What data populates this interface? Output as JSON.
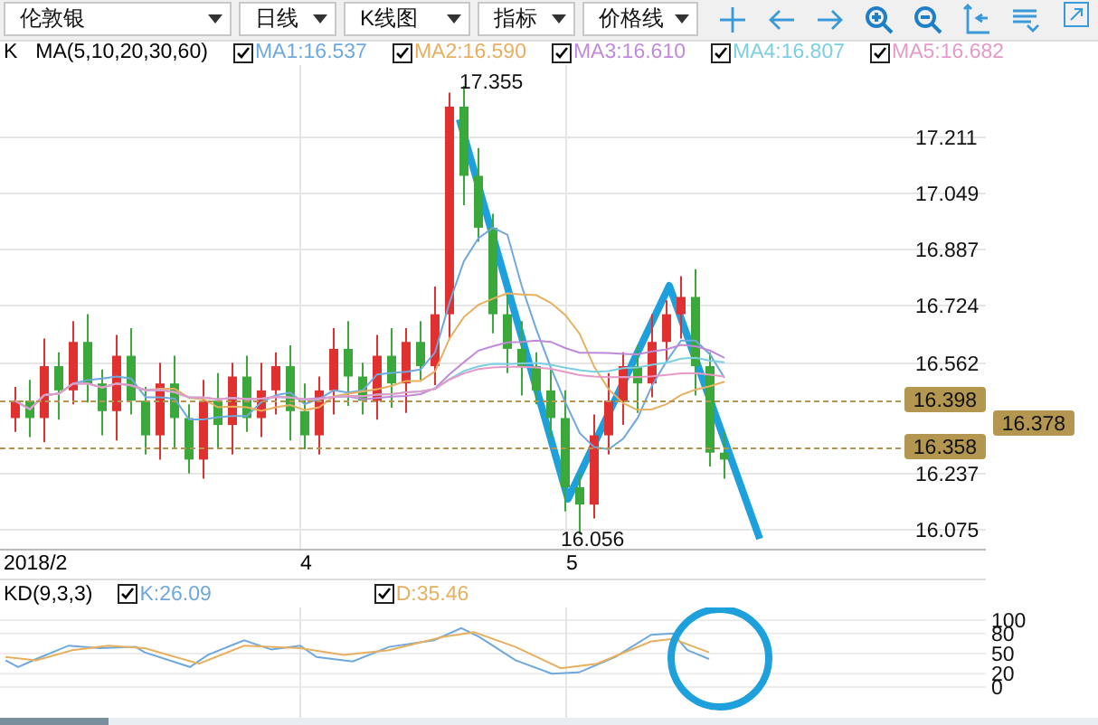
{
  "toolbar": {
    "dropdowns": [
      {
        "label": "伦敦银"
      },
      {
        "label": "日线"
      },
      {
        "label": "K线图"
      },
      {
        "label": "指标"
      },
      {
        "label": "价格线"
      }
    ]
  },
  "legend": {
    "kind_label": "K",
    "indicator": "MA(5,10,20,30,60)",
    "ma_lines": [
      {
        "label": "MA1:16.537",
        "checked": true,
        "color": "#6fa8dc"
      },
      {
        "label": "MA2:16.590",
        "checked": true,
        "color": "#e6b060"
      },
      {
        "label": "MA3:16.610",
        "checked": true,
        "color": "#c08ad8"
      },
      {
        "label": "MA4:16.807",
        "checked": true,
        "color": "#7ccfe0"
      },
      {
        "label": "MA5:16.682",
        "checked": true,
        "color": "#e59ac8"
      }
    ]
  },
  "price_chart": {
    "high_label": "17.355",
    "low_label": "16.056",
    "axis_labels": [
      "17.211",
      "17.049",
      "16.887",
      "16.724",
      "16.562",
      "16.237",
      "16.075"
    ],
    "price_tags": [
      {
        "label": "16.398",
        "kind": "line"
      },
      {
        "label": "16.378",
        "kind": "axis"
      },
      {
        "label": "16.358",
        "kind": "line"
      }
    ]
  },
  "dates": [
    "2018/2",
    "4",
    "5"
  ],
  "kd": {
    "indicator": "KD(9,3,3)",
    "lines": [
      {
        "label": "K:26.09",
        "checked": true,
        "color": "#6fa8dc"
      },
      {
        "label": "D:35.46",
        "checked": true,
        "color": "#e6b060"
      }
    ],
    "axis_labels": [
      "100",
      "80",
      "50",
      "20",
      "0"
    ]
  }
}
